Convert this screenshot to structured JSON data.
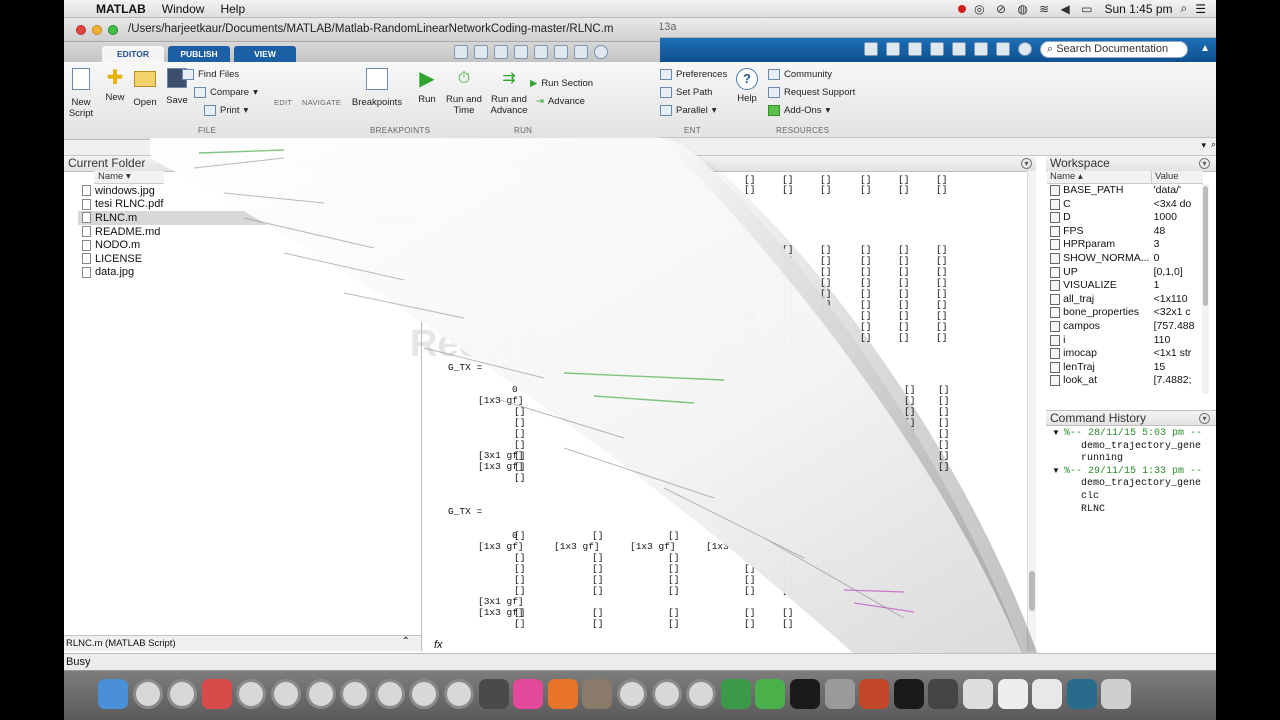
{
  "menubar": {
    "apple_glyph": "",
    "app_name": "MATLAB",
    "menu_window": "Window",
    "menu_help": "Help",
    "clock": "Sun 1:45 pm"
  },
  "main_window": {
    "title_suffix": "013a",
    "search_placeholder": "Search Documentation",
    "ribbon": {
      "preferences": "Preferences",
      "set_path": "Set Path",
      "parallel": "Parallel",
      "help": "Help",
      "community": "Community",
      "request_support": "Request Support",
      "add_ons": "Add-Ons",
      "resources_label": "RESOURCES",
      "env_label_tail": "ENT"
    }
  },
  "editor": {
    "title_path": "/Users/harjeetkaur/Documents/MATLAB/Matlab-RandomLinearNetworkCoding-master/RLNC.m",
    "tabs": [
      "EDITOR",
      "PUBLISH",
      "VIEW"
    ],
    "ribbon": {
      "new_script": "New Script",
      "new": "New",
      "open": "Open",
      "save": "Save",
      "find_files": "Find Files",
      "compare": "Compare",
      "print": "Print",
      "file_label": "FILE",
      "edit": "EDIT",
      "navigate": "NAVIGATE",
      "breakpoints": "Breakpoints",
      "breakpoints_label": "BREAKPOINTS",
      "run": "Run",
      "run_and_time": "Run and Time",
      "run_and_advance": "Run and Advance",
      "run_section": "Run Section",
      "advance": "Advance",
      "run_label": "RUN"
    }
  },
  "current_folder": {
    "title": "Current Folder",
    "column_name": "Name ▾",
    "files": [
      "windows.jpg",
      "tesi RLNC.pdf",
      "RLNC.m",
      "README.md",
      "NODO.m",
      "LICENSE",
      "data.jpg"
    ],
    "selected_detail": "RLNC.m (MATLAB Script)"
  },
  "workspace": {
    "title": "Workspace",
    "col_name": "Name ▴",
    "col_value": "Value",
    "rows": [
      {
        "name": "BASE_PATH",
        "value": "'data/'"
      },
      {
        "name": "C",
        "value": "<3x4 do"
      },
      {
        "name": "D",
        "value": "1000"
      },
      {
        "name": "FPS",
        "value": "48"
      },
      {
        "name": "HPRparam",
        "value": "3"
      },
      {
        "name": "SHOW_NORMA...",
        "value": "0"
      },
      {
        "name": "UP",
        "value": "[0,1,0]"
      },
      {
        "name": "VISUALIZE",
        "value": "1"
      },
      {
        "name": "all_traj",
        "value": "<1x110"
      },
      {
        "name": "bone_properties",
        "value": "<32x1 c"
      },
      {
        "name": "campos",
        "value": "[757.488"
      },
      {
        "name": "i",
        "value": "110"
      },
      {
        "name": "imocap",
        "value": "<1x1 str"
      },
      {
        "name": "lenTraj",
        "value": "15"
      },
      {
        "name": "look_at",
        "value": "[7.4882;"
      }
    ]
  },
  "command_history": {
    "title": "Command History",
    "lines": [
      "%-- 28/11/15 5:03 pm --",
      "demo_trajectory_gene",
      "running",
      "%-- 29/11/15 1:33 pm --",
      "demo_trajectory_gene",
      "clc",
      "RLNC"
    ]
  },
  "command_window": {
    "var1": "G_TX =",
    "var2": "G_TX =",
    "zero": "0",
    "gf13": "[1x3 gf]",
    "gf31": "[3x1 gf]",
    "empty": "[]",
    "prompt": "fx"
  },
  "status": {
    "text": "Busy"
  },
  "watermark": "Recorded with Voila",
  "colors": {
    "ribbon_blue": "#1565ad",
    "menubar": "#e8e8e8",
    "dock": "#6b6b6b"
  }
}
